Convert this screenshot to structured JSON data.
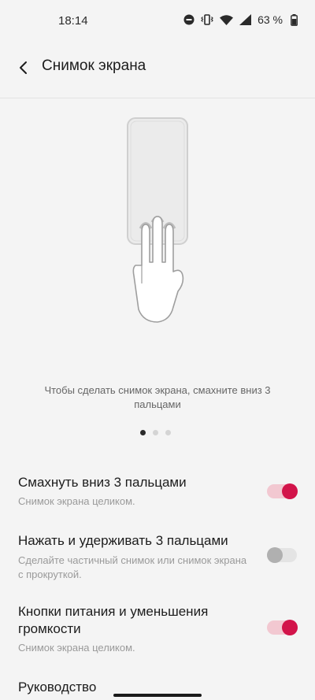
{
  "status_bar": {
    "time": "18:14",
    "battery_percent": "63 %",
    "icons": [
      "do-not-disturb-icon",
      "vibrate-icon",
      "wifi-icon",
      "cell-signal-icon",
      "battery-icon"
    ]
  },
  "header": {
    "title": "Снимок экрана",
    "back_icon": "back-arrow-icon"
  },
  "illustration": {
    "hint": "Чтобы сделать снимок экрана, смахните вниз 3 пальцами",
    "pager": {
      "count": 3,
      "active_index": 0
    }
  },
  "settings": [
    {
      "title": "Смахнуть вниз 3 пальцами",
      "subtitle": "Снимок экрана целиком.",
      "enabled": true
    },
    {
      "title": "Нажать и удерживать 3 пальцами",
      "subtitle": "Сделайте частичный снимок или снимок экрана с прокруткой.",
      "enabled": false
    },
    {
      "title": "Кнопки питания и уменьшения громкости",
      "subtitle": "Снимок экрана целиком.",
      "enabled": true
    }
  ],
  "guide": {
    "title": "Руководство"
  },
  "colors": {
    "accent": "#d2144a",
    "accent_track": "#f2c8d1",
    "background": "#f4f4f4"
  }
}
